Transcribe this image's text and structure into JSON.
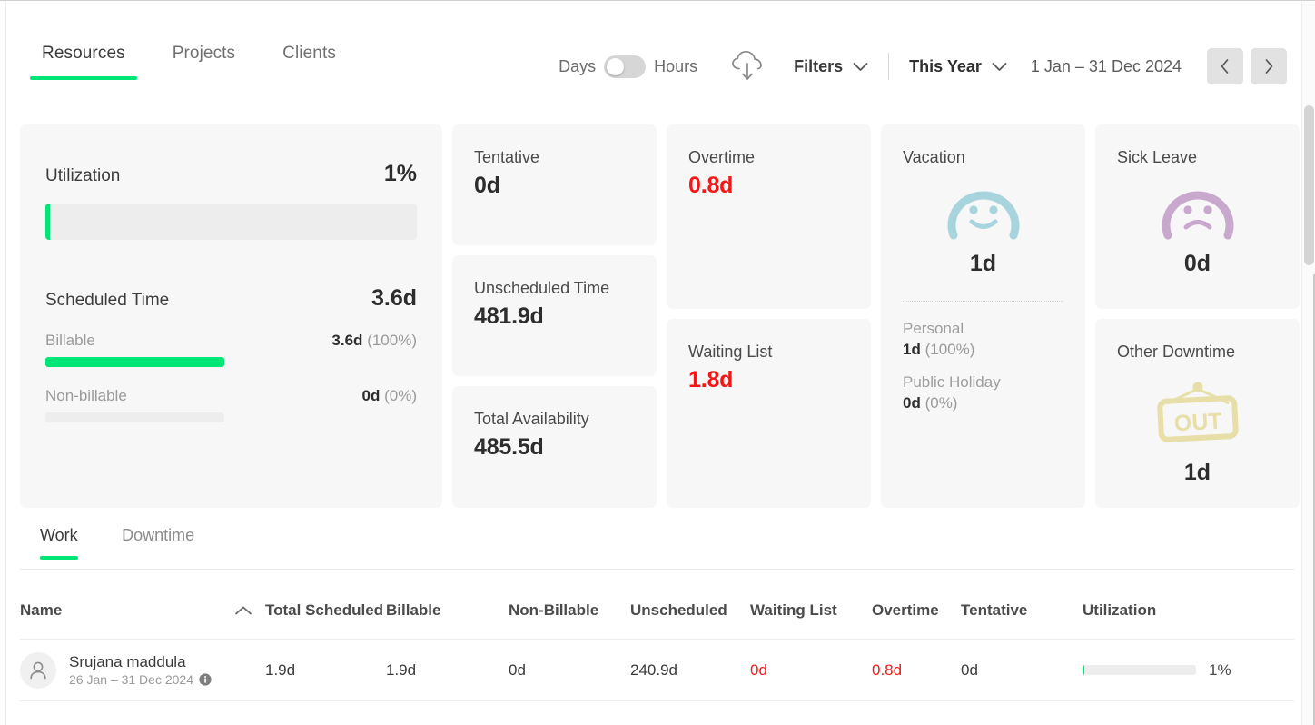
{
  "header": {
    "tabs": [
      {
        "label": "Resources",
        "active": true
      },
      {
        "label": "Projects",
        "active": false
      },
      {
        "label": "Clients",
        "active": false
      }
    ],
    "unit_toggle": {
      "left_label": "Days",
      "right_label": "Hours",
      "selected": "Days"
    },
    "download_icon": "cloud-download-icon",
    "filters": {
      "label": "Filters",
      "icon": "chevron-down-icon"
    },
    "period": {
      "label": "This Year",
      "icon": "chevron-down-icon"
    },
    "date_range": "1 Jan – 31 Dec 2024",
    "nav": {
      "prev": "‹",
      "next": "›"
    }
  },
  "cards": {
    "utilization": {
      "title": "Utilization",
      "percent_label": "1%",
      "percent_value": 1,
      "scheduled_title": "Scheduled Time",
      "scheduled_value": "3.6d",
      "billable": {
        "label": "Billable",
        "value": "3.6d",
        "percent_label": "(100%)",
        "percent": 100
      },
      "nonbillable": {
        "label": "Non-billable",
        "value": "0d",
        "percent_label": "(0%)",
        "percent": 0
      }
    },
    "tentative": {
      "label": "Tentative",
      "value": "0d"
    },
    "unscheduled": {
      "label": "Unscheduled Time",
      "value": "481.9d"
    },
    "availability": {
      "label": "Total Availability",
      "value": "485.5d"
    },
    "overtime": {
      "label": "Overtime",
      "value": "0.8d",
      "color": "#f51717"
    },
    "waiting_list": {
      "label": "Waiting List",
      "value": "1.8d",
      "color": "#f51717"
    },
    "vacation": {
      "label": "Vacation",
      "icon": "smiley-face-icon",
      "icon_color": "#A8D5DD",
      "value": "1d",
      "personal": {
        "label": "Personal",
        "value": "1d",
        "percent_label": "(100%)"
      },
      "public_holiday": {
        "label": "Public Holiday",
        "value": "0d",
        "percent_label": "(0%)"
      }
    },
    "sick_leave": {
      "label": "Sick Leave",
      "icon": "sad-face-icon",
      "icon_color": "#C9A8CE",
      "value": "0d"
    },
    "other_downtime": {
      "label": "Other Downtime",
      "icon": "out-sign-icon",
      "icon_color": "#E8DFA8",
      "icon_text": "OUT",
      "value": "1d"
    }
  },
  "subtabs": [
    {
      "label": "Work",
      "active": true
    },
    {
      "label": "Downtime",
      "active": false
    }
  ],
  "table": {
    "columns": [
      "Name",
      "Total Scheduled",
      "Billable",
      "Non-Billable",
      "Unscheduled",
      "Waiting List",
      "Overtime",
      "Tentative",
      "Utilization"
    ],
    "sort": {
      "column": "Name",
      "direction": "asc",
      "icon": "chevron-up-icon"
    },
    "rows": [
      {
        "avatar_icon": "person-icon",
        "name": "Srujana maddula",
        "date_range": "26 Jan – 31 Dec 2024",
        "info_icon": "info-icon",
        "total_scheduled": "1.9d",
        "billable": "1.9d",
        "non_billable": "0d",
        "unscheduled": "240.9d",
        "waiting_list": "0d",
        "waiting_list_red": true,
        "overtime": "0.8d",
        "overtime_red": true,
        "tentative": "0d",
        "utilization_label": "1%",
        "utilization_percent": 1
      }
    ]
  },
  "colors": {
    "accent_green": "#00E676",
    "alert_red": "#f51717"
  }
}
